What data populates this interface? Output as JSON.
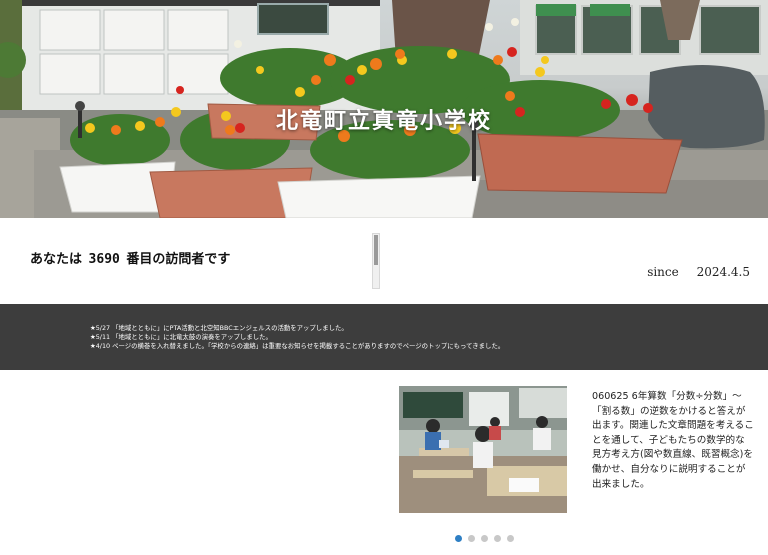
{
  "hero": {
    "school_name": "北竜町立真竜小学校"
  },
  "counter": {
    "prefix": "あなたは",
    "count": "3690",
    "suffix": "番目の訪問者です"
  },
  "since": {
    "label": "since",
    "date": "2024.4.5"
  },
  "news": [
    "★5/27 「地域とともに」にPTA活動と北空知BBCエンジェルスの活動をアップしました。",
    "★5/11 「地域とともに」に北竜太鼓の演奏をアップしました。",
    "★4/10 ページの横巻を入れ替えました。「学校からの連絡」は重要なお知らせを掲載することがありますのでページのトップにもってきました。"
  ],
  "slider": {
    "caption": "060625 6年算数「分数÷分数」〜「割る数」の逆数をかけると答えが出ます。関連した文章問題を考えることを通して、子どもたちの数学的な見方考え方(図や数直線、既習概念)を働かせ、自分なりに説明することが出来ました。",
    "slide_count": 5,
    "active_index": 0
  },
  "colors": {
    "news_band": "#3d3d3d",
    "active_dot": "#2e7fc4",
    "inactive_dot": "#c8c8c8"
  }
}
